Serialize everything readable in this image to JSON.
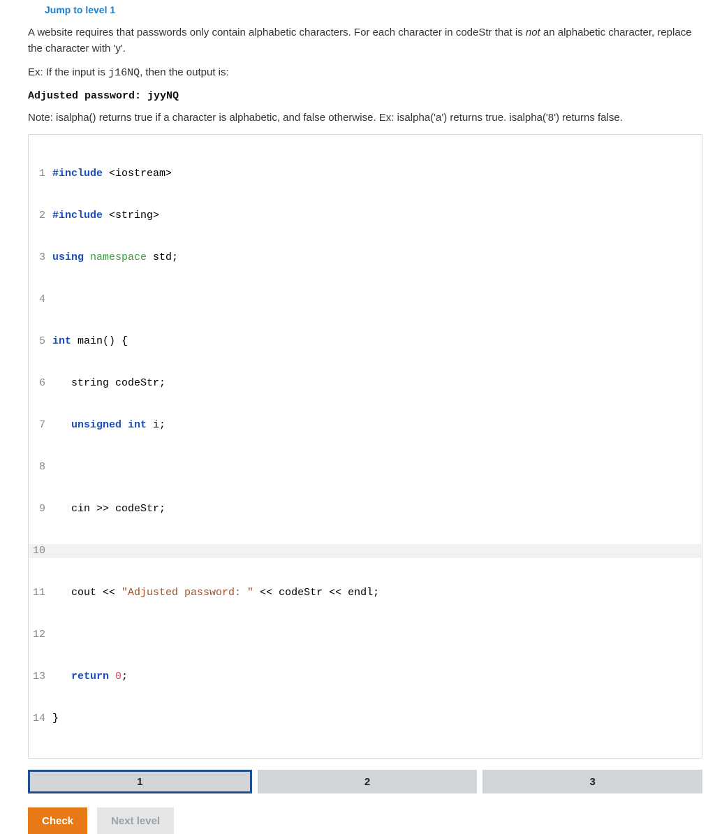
{
  "header": {
    "jump_link": "Jump to level 1"
  },
  "prompt": {
    "p1_a": "A website requires that passwords only contain alphabetic characters. For each character in codeStr that is ",
    "p1_em": "not",
    "p1_b": " an alphabetic character, replace the character with 'y'.",
    "p2_a": "Ex: If the input is ",
    "p2_code": "j16NQ",
    "p2_b": ", then the output is:",
    "example_output": "Adjusted password: jyyNQ",
    "p3": "Note: isalpha() returns true if a character is alphabetic, and false otherwise. Ex: isalpha('a') returns true. isalpha('8') returns false."
  },
  "code_lines_count": 14,
  "cursor_line": 10,
  "code": {
    "l1_include": "#include",
    "l1_rest": " <iostream>",
    "l2_include": "#include",
    "l2_rest": " <string>",
    "l3_using": "using",
    "l3_ns": " namespace",
    "l3_std": " std",
    "l3_semi": ";",
    "l5_int": "int",
    "l5_rest": " main() {",
    "l6_rest": "   string codeStr;",
    "l7_uns": "   unsigned int",
    "l7_rest": " i;",
    "l9_rest": "   cin >> codeStr;",
    "l11_a": "   cout << ",
    "l11_str": "\"Adjusted password: \"",
    "l11_b": " << codeStr << endl;",
    "l13_ret": "   return",
    "l13_sp": " ",
    "l13_num": "0",
    "l13_semi": ";",
    "l14": "}"
  },
  "tabs": [
    {
      "label": "1",
      "active": true
    },
    {
      "label": "2",
      "active": false
    },
    {
      "label": "3",
      "active": false
    }
  ],
  "buttons": {
    "check": "Check",
    "next": "Next level"
  }
}
